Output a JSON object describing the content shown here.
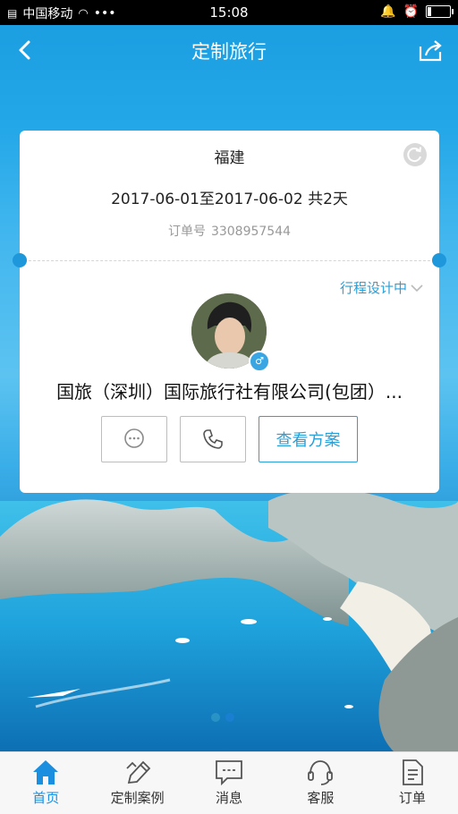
{
  "status_bar": {
    "carrier": "中国移动",
    "more": "•••",
    "time": "15:08"
  },
  "nav": {
    "title": "定制旅行",
    "back_icon": "chevron-left-icon",
    "share_icon": "share-icon"
  },
  "trip": {
    "destination": "福建",
    "dates": "2017-06-01至2017-06-02 共2天",
    "order_label": "订单号",
    "order_number": "3308957544",
    "status": "行程设计中",
    "agency": "国旅（深圳）国际旅行社有限公司(包团）...",
    "view_plan_label": "查看方案",
    "gender_symbol": "♂"
  },
  "tabs": [
    {
      "label": "首页",
      "icon": "home-icon",
      "active": true
    },
    {
      "label": "定制案例",
      "icon": "pencil-icon",
      "active": false
    },
    {
      "label": "消息",
      "icon": "message-icon",
      "active": false
    },
    {
      "label": "客服",
      "icon": "headset-icon",
      "active": false
    },
    {
      "label": "订单",
      "icon": "document-icon",
      "active": false
    }
  ],
  "colors": {
    "accent": "#1a8fe0",
    "nav_bg": "#1a9de0",
    "status_text": "#2a9fd8"
  }
}
